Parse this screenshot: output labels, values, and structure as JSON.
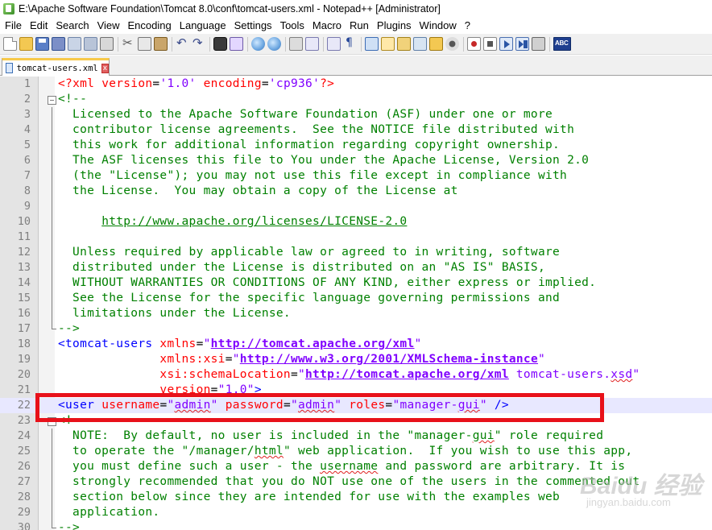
{
  "window": {
    "title": "E:\\Apache Software Foundation\\Tomcat 8.0\\conf\\tomcat-users.xml - Notepad++ [Administrator]"
  },
  "menu": [
    "File",
    "Edit",
    "Search",
    "View",
    "Encoding",
    "Language",
    "Settings",
    "Tools",
    "Macro",
    "Run",
    "Plugins",
    "Window",
    "?"
  ],
  "toolbar": {
    "icons": [
      "new-file-icon",
      "open-file-icon",
      "save-icon",
      "save-all-icon",
      "close-icon",
      "close-all-icon",
      "print-icon",
      "cut-icon",
      "copy-icon",
      "paste-icon",
      "undo-icon",
      "redo-icon",
      "find-icon",
      "replace-icon",
      "zoom-in-icon",
      "zoom-out-icon",
      "sync-scroll-icon",
      "word-wrap-icon",
      "show-all-chars-icon",
      "indent-guide-icon",
      "user-defined-language-icon",
      "document-map-icon",
      "function-list-icon",
      "folder-workspace-icon",
      "monitoring-icon",
      "record-macro-icon",
      "stop-recording-icon",
      "play-macro-icon",
      "run-macro-multiple-icon",
      "save-macro-icon",
      "spell-check-icon"
    ],
    "spell_label": "ABC"
  },
  "tab": {
    "label": "tomcat-users.xml",
    "close": "x"
  },
  "editor": {
    "current_line": 22,
    "lines": [
      {
        "n": "1",
        "fold": "none",
        "parts": [
          {
            "t": "<?",
            "c": "pi"
          },
          {
            "t": "xml ",
            "c": "pi"
          },
          {
            "t": "version",
            "c": "attr"
          },
          {
            "t": "=",
            "c": "black"
          },
          {
            "t": "'1.0'",
            "c": "val"
          },
          {
            "t": " ",
            "c": "black"
          },
          {
            "t": "encoding",
            "c": "attr"
          },
          {
            "t": "=",
            "c": "black"
          },
          {
            "t": "'cp936'",
            "c": "val"
          },
          {
            "t": "?>",
            "c": "pi"
          }
        ]
      },
      {
        "n": "2",
        "fold": "box",
        "parts": [
          {
            "t": "<!--",
            "c": "comment"
          }
        ]
      },
      {
        "n": "3",
        "fold": "bar",
        "parts": [
          {
            "t": "  Licensed to the Apache Software Foundation (ASF) under one or more",
            "c": "comment"
          }
        ]
      },
      {
        "n": "4",
        "fold": "bar",
        "parts": [
          {
            "t": "  contributor license agreements.  See the NOTICE file distributed with",
            "c": "comment"
          }
        ]
      },
      {
        "n": "5",
        "fold": "bar",
        "parts": [
          {
            "t": "  this work for additional information regarding copyright ownership.",
            "c": "comment"
          }
        ]
      },
      {
        "n": "6",
        "fold": "bar",
        "parts": [
          {
            "t": "  The ASF licenses this file to You under the Apache License, Version 2.0",
            "c": "comment"
          }
        ]
      },
      {
        "n": "7",
        "fold": "bar",
        "parts": [
          {
            "t": "  (the \"License\"); you may not use this file except in compliance with",
            "c": "comment"
          }
        ]
      },
      {
        "n": "8",
        "fold": "bar",
        "parts": [
          {
            "t": "  the License.  You may obtain a copy of the License at",
            "c": "comment"
          }
        ]
      },
      {
        "n": "9",
        "fold": "bar",
        "parts": []
      },
      {
        "n": "10",
        "fold": "bar",
        "parts": [
          {
            "t": "      ",
            "c": "comment"
          },
          {
            "t": "http://www.apache.org/licenses/LICENSE-2.0",
            "c": "link"
          }
        ]
      },
      {
        "n": "11",
        "fold": "bar",
        "parts": []
      },
      {
        "n": "12",
        "fold": "bar",
        "parts": [
          {
            "t": "  Unless required by applicable law or agreed to in writing, software",
            "c": "comment"
          }
        ]
      },
      {
        "n": "13",
        "fold": "bar",
        "parts": [
          {
            "t": "  distributed under the License is distributed on an \"AS IS\" BASIS,",
            "c": "comment"
          }
        ]
      },
      {
        "n": "14",
        "fold": "bar",
        "parts": [
          {
            "t": "  WITHOUT WARRANTIES OR CONDITIONS OF ANY KIND, either express or implied.",
            "c": "comment"
          }
        ]
      },
      {
        "n": "15",
        "fold": "bar",
        "parts": [
          {
            "t": "  See the License for the specific language governing permissions and",
            "c": "comment"
          }
        ]
      },
      {
        "n": "16",
        "fold": "bar",
        "parts": [
          {
            "t": "  limitations under the License.",
            "c": "comment"
          }
        ]
      },
      {
        "n": "17",
        "fold": "end",
        "parts": [
          {
            "t": "-->",
            "c": "comment"
          }
        ]
      },
      {
        "n": "18",
        "fold": "none",
        "parts": [
          {
            "t": "<tomcat-users ",
            "c": "tag"
          },
          {
            "t": "xmlns",
            "c": "attr"
          },
          {
            "t": "=",
            "c": "black"
          },
          {
            "t": "\"",
            "c": "val"
          },
          {
            "t": "http://tomcat.apache.org/xml",
            "c": "url"
          },
          {
            "t": "\"",
            "c": "val"
          }
        ]
      },
      {
        "n": "19",
        "fold": "none",
        "parts": [
          {
            "t": "              ",
            "c": "black"
          },
          {
            "t": "xmlns:xsi",
            "c": "attr"
          },
          {
            "t": "=",
            "c": "black"
          },
          {
            "t": "\"",
            "c": "val"
          },
          {
            "t": "http://www.w3.org/2001/XMLSchema-instance",
            "c": "url"
          },
          {
            "t": "\"",
            "c": "val"
          }
        ]
      },
      {
        "n": "20",
        "fold": "none",
        "parts": [
          {
            "t": "              ",
            "c": "black"
          },
          {
            "t": "xsi:schemaLocation",
            "c": "attr"
          },
          {
            "t": "=",
            "c": "black"
          },
          {
            "t": "\"",
            "c": "val"
          },
          {
            "t": "http://tomcat.apache.org/xml",
            "c": "url"
          },
          {
            "t": " tomcat-users.",
            "c": "val"
          },
          {
            "t": "xsd",
            "c": "valsq"
          },
          {
            "t": "\"",
            "c": "val"
          }
        ]
      },
      {
        "n": "21",
        "fold": "none",
        "parts": [
          {
            "t": "              ",
            "c": "black"
          },
          {
            "t": "version",
            "c": "attr"
          },
          {
            "t": "=",
            "c": "black"
          },
          {
            "t": "\"1.0\"",
            "c": "val"
          },
          {
            "t": ">",
            "c": "tag"
          }
        ]
      },
      {
        "n": "22",
        "fold": "none",
        "parts": [
          {
            "t": "<user ",
            "c": "tag"
          },
          {
            "t": "username",
            "c": "attr"
          },
          {
            "t": "=",
            "c": "black"
          },
          {
            "t": "\"",
            "c": "val"
          },
          {
            "t": "admin",
            "c": "valsq"
          },
          {
            "t": "\"",
            "c": "val"
          },
          {
            "t": " ",
            "c": "black"
          },
          {
            "t": "password",
            "c": "attr"
          },
          {
            "t": "=",
            "c": "black"
          },
          {
            "t": "\"",
            "c": "val"
          },
          {
            "t": "admin",
            "c": "valsq"
          },
          {
            "t": "\"",
            "c": "val"
          },
          {
            "t": " ",
            "c": "black"
          },
          {
            "t": "roles",
            "c": "attr"
          },
          {
            "t": "=",
            "c": "black"
          },
          {
            "t": "\"manager-",
            "c": "val"
          },
          {
            "t": "gui",
            "c": "valsq"
          },
          {
            "t": "\"",
            "c": "val"
          },
          {
            "t": " />",
            "c": "tag"
          }
        ]
      },
      {
        "n": "23",
        "fold": "box",
        "parts": [
          {
            "t": "<!--",
            "c": "comment"
          }
        ]
      },
      {
        "n": "24",
        "fold": "bar",
        "parts": [
          {
            "t": "  NOTE:  By default, no user is included in the \"manager-",
            "c": "comment"
          },
          {
            "t": "gui",
            "c": "commentsq"
          },
          {
            "t": "\" role required",
            "c": "comment"
          }
        ]
      },
      {
        "n": "25",
        "fold": "bar",
        "parts": [
          {
            "t": "  to operate the \"/manager/",
            "c": "comment"
          },
          {
            "t": "html",
            "c": "commentsq"
          },
          {
            "t": "\" web application.  If you wish to use this app,",
            "c": "comment"
          }
        ]
      },
      {
        "n": "26",
        "fold": "bar",
        "parts": [
          {
            "t": "  you must define such a user - the ",
            "c": "comment"
          },
          {
            "t": "username",
            "c": "commentsq"
          },
          {
            "t": " and password are arbitrary. It is",
            "c": "comment"
          }
        ]
      },
      {
        "n": "27",
        "fold": "bar",
        "parts": [
          {
            "t": "  strongly recommended that you do NOT use one of the users in the commented out",
            "c": "comment"
          }
        ]
      },
      {
        "n": "28",
        "fold": "bar",
        "parts": [
          {
            "t": "  section below since they are intended for use with the examples web",
            "c": "comment"
          }
        ]
      },
      {
        "n": "29",
        "fold": "bar",
        "parts": [
          {
            "t": "  application.",
            "c": "comment"
          }
        ]
      },
      {
        "n": "30",
        "fold": "end",
        "parts": [
          {
            "t": "-->",
            "c": "comment"
          }
        ]
      }
    ]
  },
  "highlight": {
    "color": "#e8111a",
    "target_line": 22
  },
  "watermark": {
    "main": "Baidu 经验",
    "sub": "jingyan.baidu.com"
  },
  "colors": {
    "comment": "#008000",
    "tag": "#0000ff",
    "attribute": "#ff0000",
    "value": "#8000ff",
    "current_line_bg": "#e8e8ff"
  }
}
